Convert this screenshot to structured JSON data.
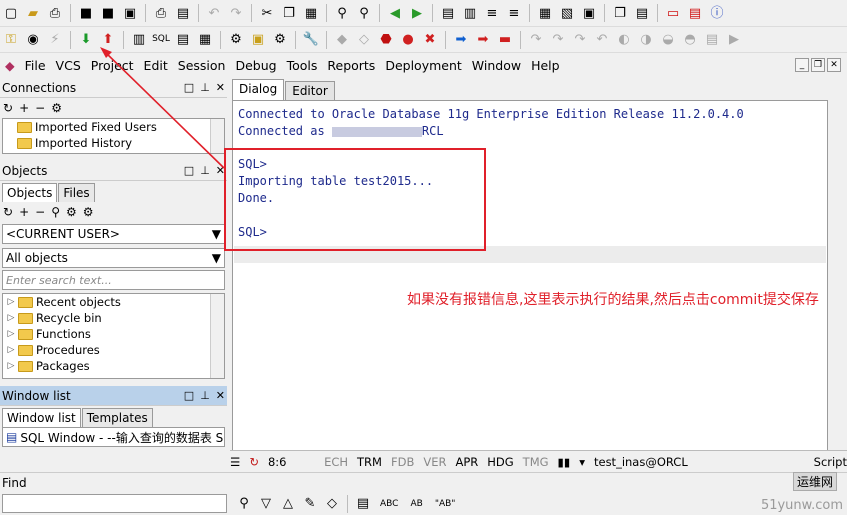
{
  "menu": [
    "File",
    "VCS",
    "Project",
    "Edit",
    "Session",
    "Debug",
    "Tools",
    "Reports",
    "Deployment",
    "Window",
    "Help"
  ],
  "connections": {
    "title": "Connections",
    "items": [
      "Imported Fixed Users",
      "Imported History"
    ]
  },
  "objects": {
    "title": "Objects",
    "tabs": [
      "Objects",
      "Files"
    ],
    "user": "<CURRENT USER>",
    "filter": "All objects",
    "search_placeholder": "Enter search text...",
    "items": [
      "Recent objects",
      "Recycle bin",
      "Functions",
      "Procedures",
      "Packages"
    ]
  },
  "window_list": {
    "title": "Window list",
    "tabs": [
      "Window list",
      "Templates"
    ],
    "item": "SQL Window - --输入查询的数据表 S"
  },
  "dialog": {
    "tabs": [
      "Dialog",
      "Editor"
    ],
    "lines": [
      "Connected to Oracle Database 11g Enterprise Edition Release 11.2.0.4.0",
      "Connected as ",
      "SQL>",
      "Importing table test2015...",
      "Done.",
      "SQL>"
    ],
    "masked_suffix": "RCL"
  },
  "annotation": "如果没有报错信息,这里表示执行的结果,然后点击commit提交保存",
  "status": {
    "pos": "8:6",
    "flags": [
      "ECH",
      "TRM",
      "FDB",
      "VER",
      "APR",
      "HDG",
      "TMG"
    ],
    "connection": "test_inas@ORCL",
    "script": "Script"
  },
  "find": {
    "label": "Find"
  },
  "bottom_labels": [
    "ABC",
    "AB",
    "\"AB\""
  ],
  "watermark": {
    "site": "运维网",
    "host": "51yunw.com"
  },
  "colors": {
    "accent_red": "#e0202a",
    "output_blue": "#1e2a8c"
  }
}
